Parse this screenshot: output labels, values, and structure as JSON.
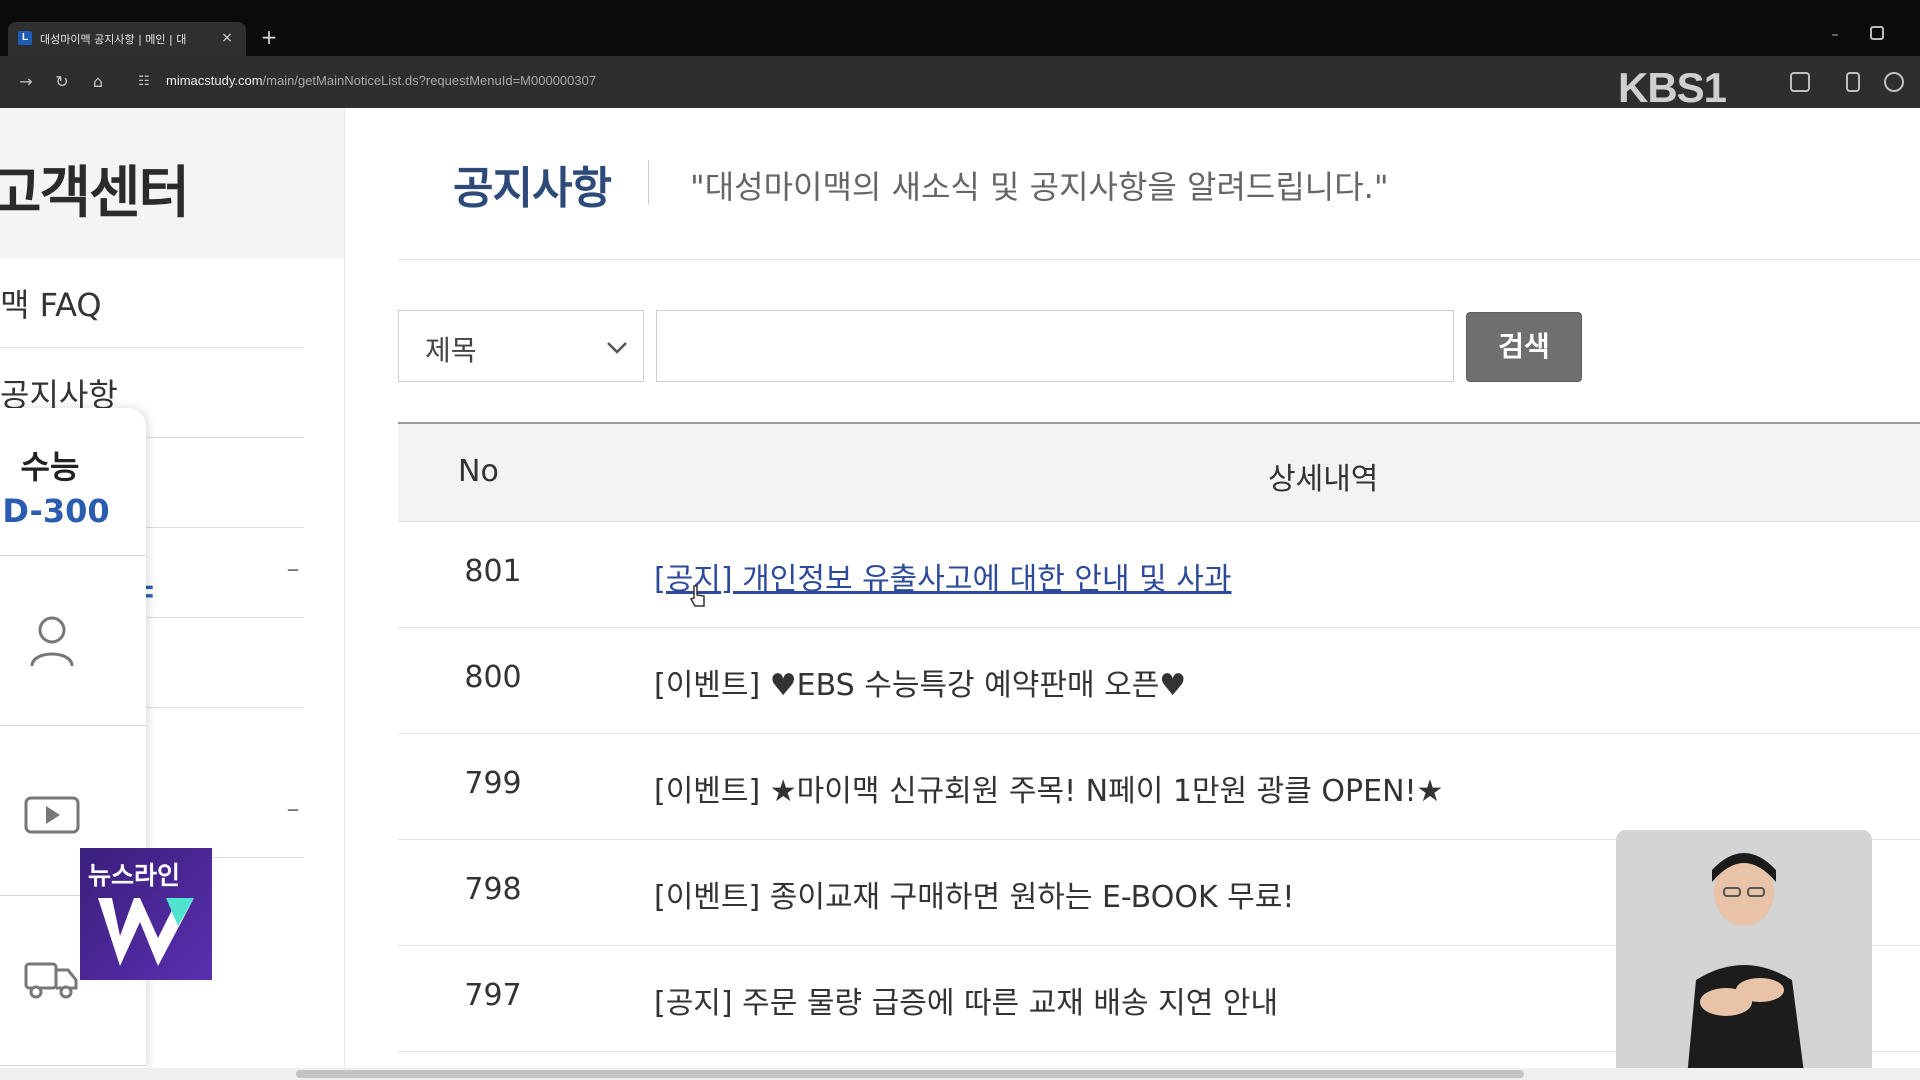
{
  "browser": {
    "tab_title": "대성마이맥 공지사항 | 메인 | 대",
    "tab_close": "×",
    "new_tab": "+",
    "window_minimize": "–",
    "url_host": "mimacstudy.com",
    "url_path": "/main/getMainNoticeList.ds?requestMenuId=M000000307",
    "broadcast_logo": "KBS1"
  },
  "sidebar": {
    "title": "고객센터",
    "items": [
      {
        "label": "맥 FAQ"
      },
      {
        "label": "공지사항"
      },
      {
        "label": ""
      },
      {
        "label": "",
        "toggle": "–"
      },
      {
        "label": ""
      },
      {
        "label": "",
        "toggle": "–"
      }
    ],
    "active_fragment": "ㅑ"
  },
  "quick_bar": {
    "dday_label": "수능",
    "dday_value": "D-300",
    "icons": [
      "user-icon",
      "play-icon",
      "truck-icon"
    ]
  },
  "newsline": {
    "text": "뉴스라인",
    "logo_letter": "W"
  },
  "main": {
    "title": "공지사항",
    "subtitle": "\"대성마이맥의 새소식 및 공지사항을 알려드립니다.\"",
    "search": {
      "select_value": "제목",
      "input_value": "",
      "input_placeholder": "",
      "button_label": "검색"
    },
    "table": {
      "headers": {
        "no": "No",
        "detail": "상세내역"
      },
      "rows": [
        {
          "no": "801",
          "title": "[공지] 개인정보 유출사고에 대한 안내 및 사과",
          "link": true
        },
        {
          "no": "800",
          "title": "[이벤트] ♥EBS 수능특강 예약판매 오픈♥",
          "link": false
        },
        {
          "no": "799",
          "title": "[이벤트] ★마이맥 신규회원 주목! N페이 1만원 광클 OPEN!★",
          "link": false
        },
        {
          "no": "798",
          "title": "[이벤트] 종이교재 구매하면 원하는 E-BOOK 무료!",
          "link": false
        },
        {
          "no": "797",
          "title": "[공지] 주문 물량 급증에 따른 교재 배송 지연 안내",
          "link": false
        }
      ]
    }
  },
  "colors": {
    "accent_blue": "#2a5db0",
    "title_navy": "#2d4a78",
    "link": "#2d4a9a",
    "search_button": "#6f6f6f"
  }
}
